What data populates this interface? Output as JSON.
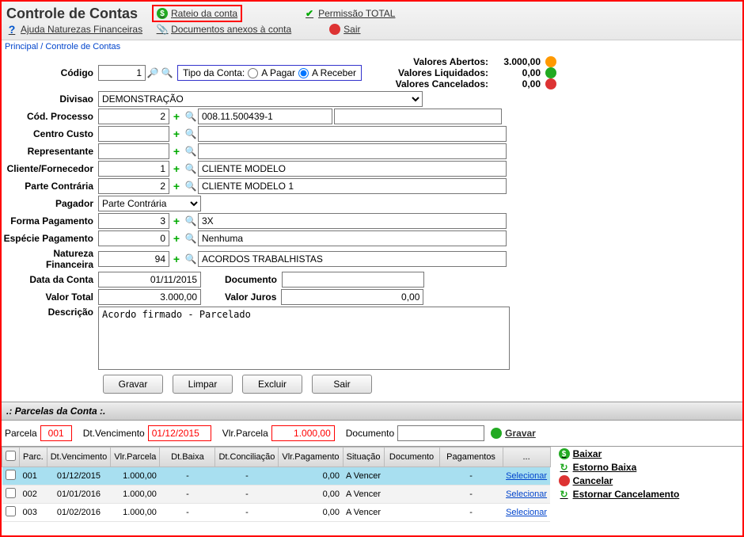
{
  "header": {
    "title": "Controle de Contas",
    "link_rateio": "Rateio da conta",
    "link_permissao": "Permissão TOTAL",
    "link_ajuda": "Ajuda Naturezas Financeiras",
    "link_anexos": "Documentos anexos à conta",
    "link_sair": "Sair"
  },
  "breadcrumb": "Principal / Controle de Contas",
  "labels": {
    "codigo": "Código",
    "divisao": "Divisao",
    "cod_processo": "Cód. Processo",
    "centro_custo": "Centro Custo",
    "representante": "Representante",
    "cliente_fornecedor": "Cliente/Fornecedor",
    "parte_contraria": "Parte Contrária",
    "pagador": "Pagador",
    "forma_pagamento": "Forma Pagamento",
    "especie_pagamento": "Espécie Pagamento",
    "natureza_financeira": "Natureza Financeira",
    "data_conta": "Data da Conta",
    "documento": "Documento",
    "valor_total": "Valor Total",
    "valor_juros": "Valor Juros",
    "descricao": "Descrição",
    "tipo_conta": "Tipo da Conta:",
    "a_pagar": "A Pagar",
    "a_receber": "A Receber"
  },
  "values": {
    "codigo": "1",
    "divisao": "DEMONSTRAÇÃO",
    "cod_processo": "2",
    "cod_processo_desc": "008.11.500439-1",
    "centro_custo": "",
    "centro_custo_desc": "",
    "representante": "",
    "representante_desc": "",
    "cliente_fornecedor": "1",
    "cliente_fornecedor_desc": "CLIENTE MODELO",
    "parte_contraria": "2",
    "parte_contraria_desc": "CLIENTE MODELO 1",
    "pagador": "Parte Contrária",
    "forma_pagamento": "3",
    "forma_pagamento_desc": "3X",
    "especie_pagamento": "0",
    "especie_pagamento_desc": "Nenhuma",
    "natureza_financeira": "94",
    "natureza_financeira_desc": "ACORDOS TRABALHISTAS",
    "data_conta": "01/11/2015",
    "documento": "",
    "valor_total": "3.000,00",
    "valor_juros": "0,00",
    "descricao": "Acordo firmado - Parcelado"
  },
  "summary": {
    "abertos_lbl": "Valores Abertos:",
    "abertos_val": "3.000,00",
    "liquidados_lbl": "Valores Liquidados:",
    "liquidados_val": "0,00",
    "cancelados_lbl": "Valores Cancelados:",
    "cancelados_val": "0,00"
  },
  "buttons": {
    "gravar": "Gravar",
    "limpar": "Limpar",
    "excluir": "Excluir",
    "sair": "Sair"
  },
  "parcelas": {
    "section_title": ".: Parcelas da Conta :.",
    "lbl_parcela": "Parcela",
    "lbl_vencimento": "Dt.Vencimento",
    "lbl_valor": "Vlr.Parcela",
    "lbl_documento": "Documento",
    "btn_gravar": "Gravar",
    "entry_parcela": "001",
    "entry_venc": "01/12/2015",
    "entry_valor": "1.000,00",
    "entry_doc": "",
    "cols": {
      "chk": "",
      "parc": "Parc.",
      "venc": "Dt.Vencimento",
      "vlr": "Vlr.Parcela",
      "baixa": "Dt.Baixa",
      "concil": "Dt.Conciliação",
      "vlrpag": "Vlr.Pagamento",
      "sit": "Situação",
      "doc": "Documento",
      "pag": "Pagamentos",
      "act": "..."
    },
    "rows": [
      {
        "parc": "001",
        "venc": "01/12/2015",
        "vlr": "1.000,00",
        "baixa": "-",
        "concil": "-",
        "vlrpag": "0,00",
        "sit": "A Vencer",
        "doc": "",
        "pag": "-",
        "act": "Selecionar"
      },
      {
        "parc": "002",
        "venc": "01/01/2016",
        "vlr": "1.000,00",
        "baixa": "-",
        "concil": "-",
        "vlrpag": "0,00",
        "sit": "A Vencer",
        "doc": "",
        "pag": "-",
        "act": "Selecionar"
      },
      {
        "parc": "003",
        "venc": "01/02/2016",
        "vlr": "1.000,00",
        "baixa": "-",
        "concil": "-",
        "vlrpag": "0,00",
        "sit": "A Vencer",
        "doc": "",
        "pag": "-",
        "act": "Selecionar"
      }
    ]
  },
  "side_actions": {
    "baixar": "Baixar",
    "estorno_baixa": "Estorno Baixa",
    "cancelar": "Cancelar",
    "estornar_cancelamento": "Estornar Cancelamento"
  }
}
